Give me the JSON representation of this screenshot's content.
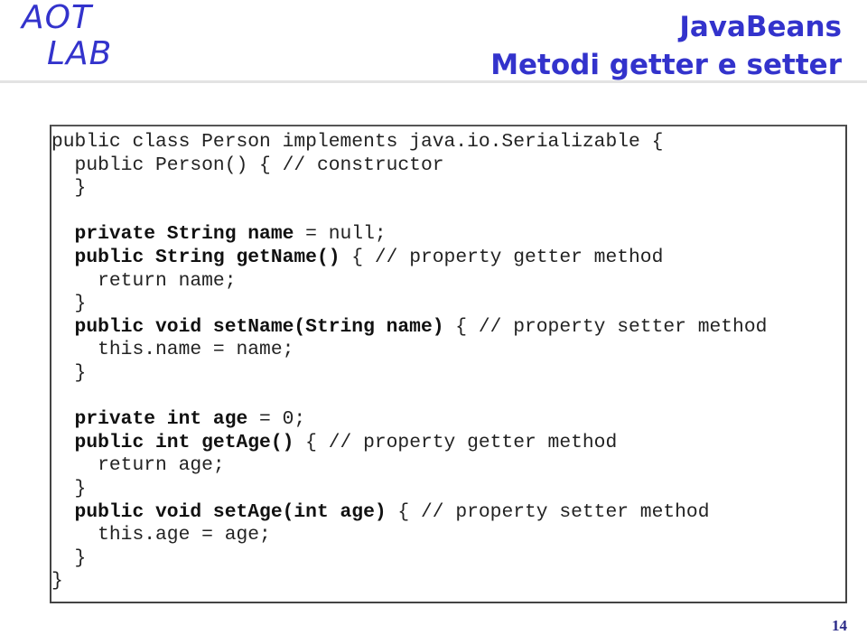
{
  "header": {
    "logo_line1": "AOT",
    "logo_line2": "LAB",
    "title_line1": "JavaBeans",
    "title_line2": "Metodi getter e setter",
    "accent_color": "#3333cc"
  },
  "code": {
    "language": "java",
    "lines": [
      {
        "plain": "public class Person implements java.io.Serializable {",
        "bold": ""
      },
      {
        "plain": "  public Person() { // constructor",
        "bold": ""
      },
      {
        "plain": "  }",
        "bold": ""
      },
      {
        "plain": "",
        "bold": ""
      },
      {
        "bold": "  private String name",
        "plain": " = null;"
      },
      {
        "bold": "  public String getName()",
        "plain": " { // property getter method"
      },
      {
        "plain": "    return name;",
        "bold": ""
      },
      {
        "plain": "  }",
        "bold": ""
      },
      {
        "bold": "  public void setName(String name)",
        "plain": " { // property setter method"
      },
      {
        "plain": "    this.name = name;",
        "bold": ""
      },
      {
        "plain": "  }",
        "bold": ""
      },
      {
        "plain": "",
        "bold": ""
      },
      {
        "bold": "  private int age",
        "plain": " = 0;"
      },
      {
        "bold": "  public int getAge()",
        "plain": " { // property getter method"
      },
      {
        "plain": "    return age;",
        "bold": ""
      },
      {
        "plain": "  }",
        "bold": ""
      },
      {
        "bold": "  public void setAge(int age)",
        "plain": " { // property setter method"
      },
      {
        "plain": "    this.age = age;",
        "bold": ""
      },
      {
        "plain": "  }",
        "bold": ""
      },
      {
        "plain": "}",
        "bold": ""
      }
    ]
  },
  "footer": {
    "page_number": "14"
  }
}
